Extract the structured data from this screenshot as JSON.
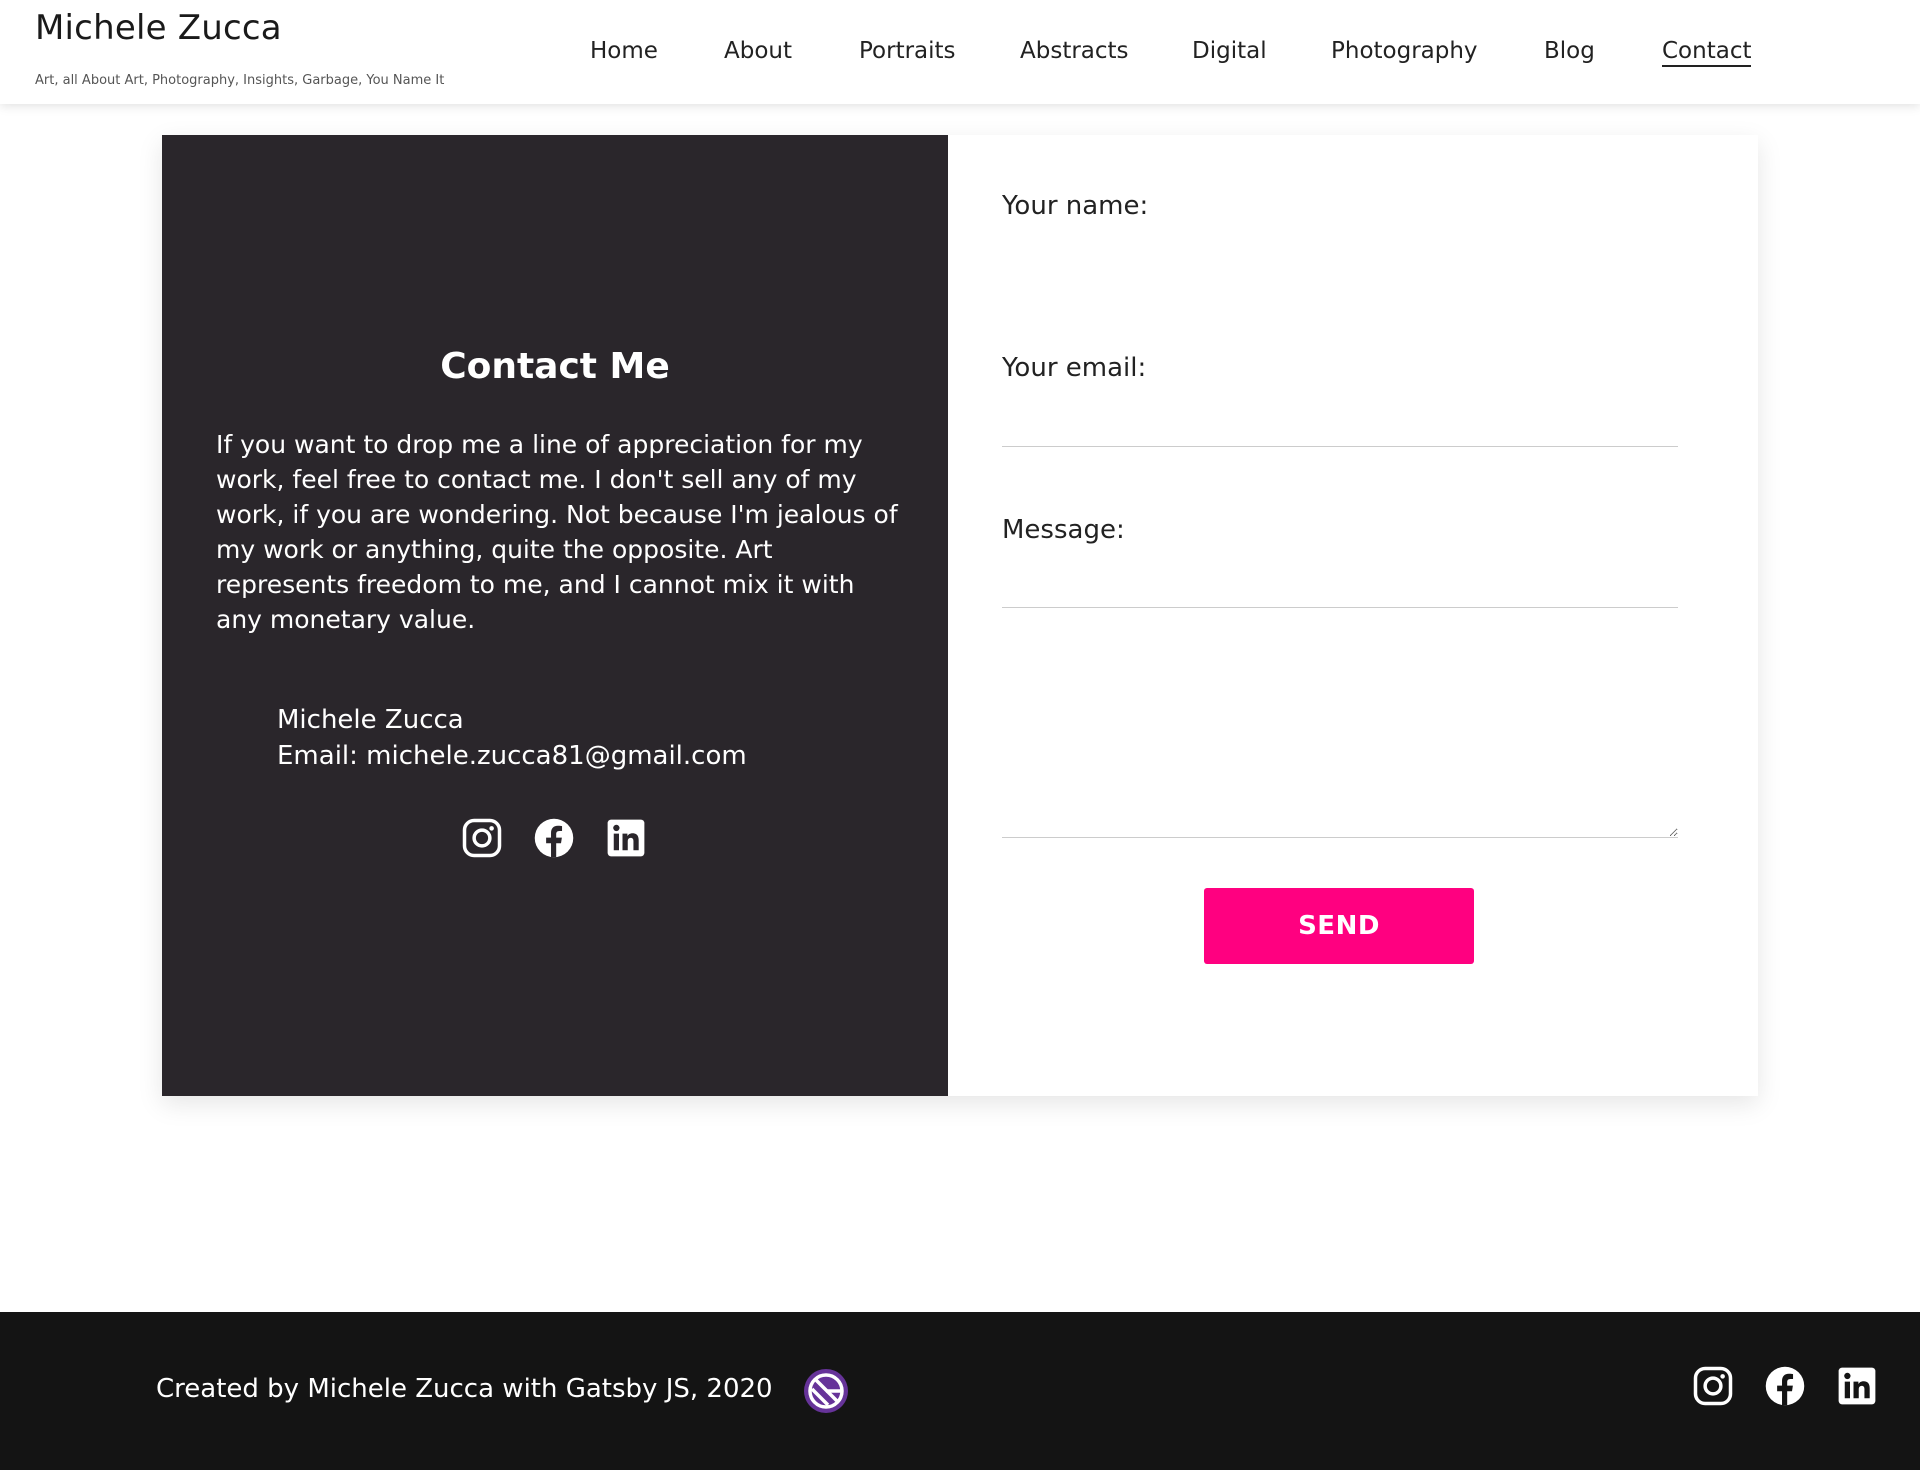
{
  "header": {
    "site_title": "Michele Zucca",
    "tagline": "Art, all About Art, Photography, Insights, Garbage, You Name It",
    "nav": [
      {
        "label": "Home"
      },
      {
        "label": "About"
      },
      {
        "label": "Portraits"
      },
      {
        "label": "Abstracts"
      },
      {
        "label": "Digital"
      },
      {
        "label": "Photography"
      },
      {
        "label": "Blog"
      },
      {
        "label": "Contact",
        "active": true
      }
    ]
  },
  "contact_panel": {
    "heading": "Contact Me",
    "body": "If you want to drop me a line of appreciation for my work, feel free to contact me. I don't sell any of my work, if you are wondering. Not because I'm jealous of my work or anything, quite the opposite. Art represents freedom to me, and I cannot mix it with any monetary value.",
    "name": "Michele Zucca",
    "email": "Email: michele.zucca81@gmail.com",
    "social_icons": [
      "instagram-icon",
      "facebook-icon",
      "linkedin-icon"
    ]
  },
  "form": {
    "name_label": "Your name:",
    "name_value": "",
    "email_label": "Your email:",
    "email_value": "",
    "message_label": "Message:",
    "message_value": "",
    "send_label": "SEND"
  },
  "footer": {
    "credit": "Created by Michele Zucca with Gatsby JS, 2020",
    "credit_icon": "gatsby-icon",
    "social_icons": [
      "instagram-icon",
      "facebook-icon",
      "linkedin-icon"
    ]
  },
  "colors": {
    "panel_background": "#2a262b",
    "send_button": "#ff0080",
    "footer_background": "#141414",
    "gatsby_purple": "#663399"
  }
}
